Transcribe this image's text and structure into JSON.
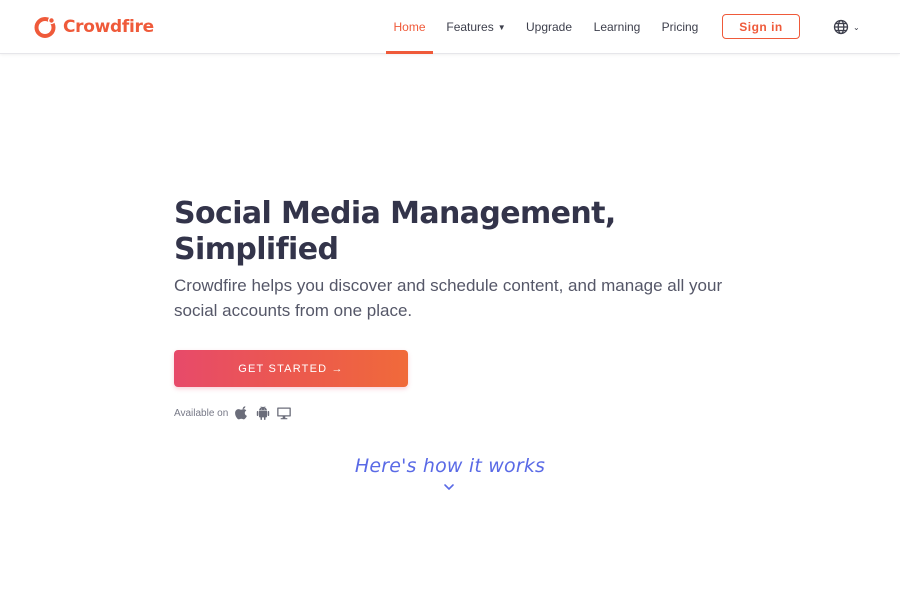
{
  "brand": {
    "name": "Crowdfire",
    "color": "#ef5a3a"
  },
  "nav": {
    "items": [
      {
        "label": "Home",
        "active": true
      },
      {
        "label": "Features",
        "has_dropdown": true
      },
      {
        "label": "Upgrade"
      },
      {
        "label": "Learning"
      },
      {
        "label": "Pricing"
      }
    ],
    "signin_label": "Sign in",
    "language_icon": "globe-icon"
  },
  "hero": {
    "title_line1": "Social Media Management,",
    "title_line2": "Simplified",
    "subtitle": "Crowdfire helps you discover and schedule content, and manage all your social accounts from one place.",
    "cta_label": "GET STARTED →",
    "available_label": "Available on",
    "platforms": [
      "apple-icon",
      "android-icon",
      "desktop-icon"
    ]
  },
  "how_it_works": {
    "label": "Here's how it works",
    "icon": "chevron-down-icon"
  },
  "colors": {
    "accent": "#ef5a3a",
    "gradient_start": "#e74a6a",
    "gradient_end": "#f06a3a",
    "script_blue": "#5a6ae6"
  }
}
